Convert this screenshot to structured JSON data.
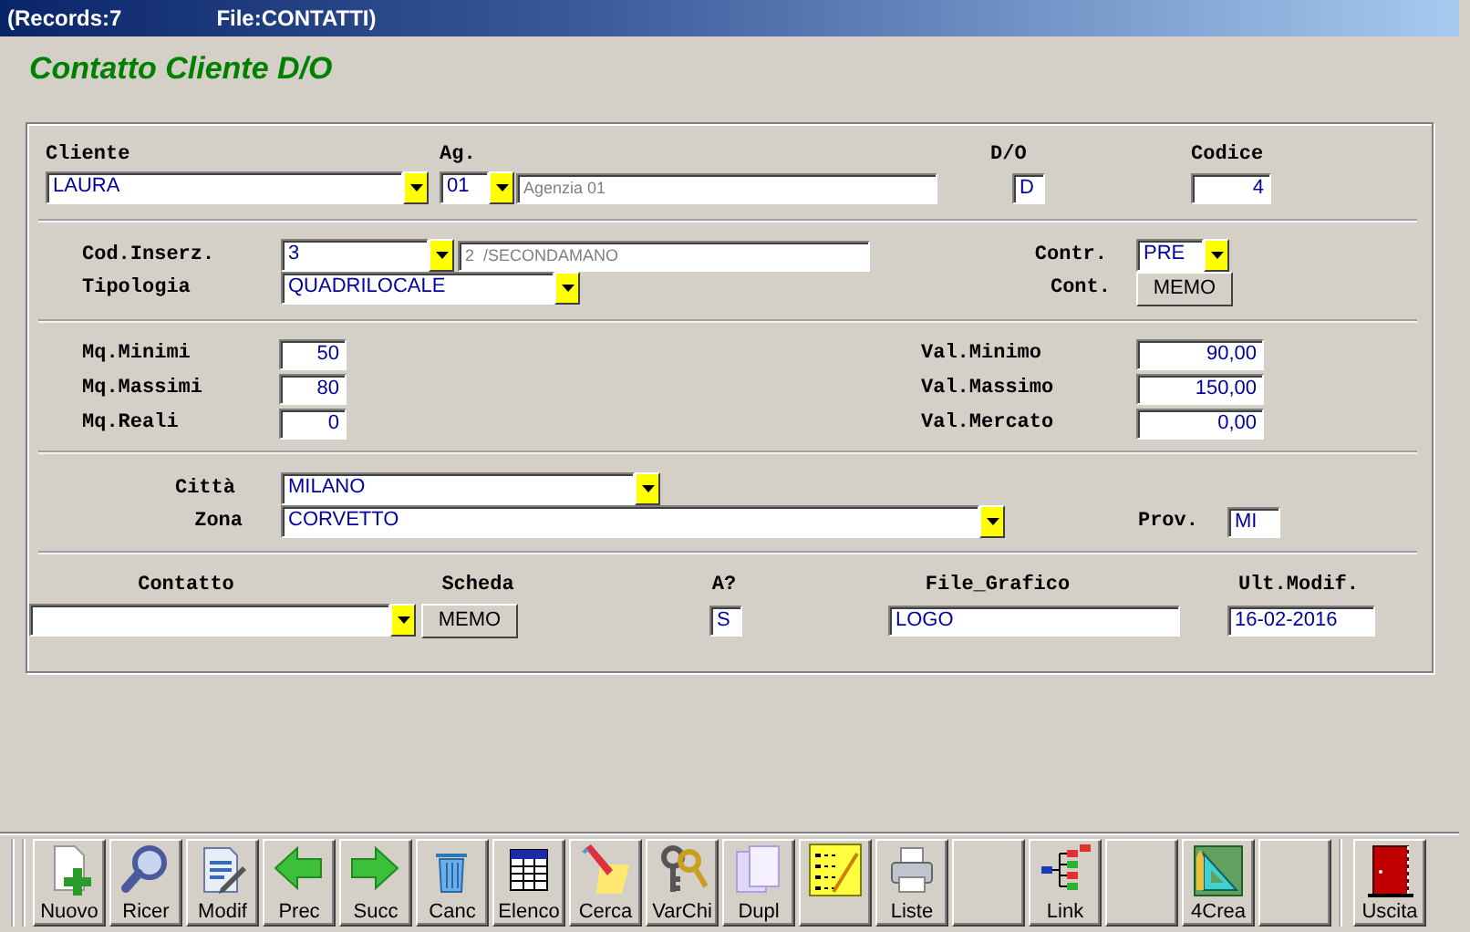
{
  "window": {
    "records": "(Records:7",
    "file": "File:CONTATTI)"
  },
  "heading": "Contatto Cliente D/O",
  "sections": [
    {
      "rows": [
        {
          "items": [
            {
              "kind": "label",
              "text": "Cliente"
            },
            {
              "kind": "label",
              "text": "Ag."
            },
            {
              "kind": "label",
              "text": "D/O"
            },
            {
              "kind": "label",
              "text": "Codice"
            }
          ]
        },
        {
          "items": [
            {
              "kind": "combo",
              "value": "LAURA"
            },
            {
              "kind": "combo",
              "value": "01"
            },
            {
              "kind": "description",
              "value": "Agenzia 01"
            },
            {
              "kind": "field",
              "value": "D"
            },
            {
              "kind": "number",
              "value": "4"
            }
          ]
        }
      ]
    },
    {
      "rows": [
        {
          "items": [
            {
              "kind": "label",
              "text": "Cod.Inserz."
            },
            {
              "kind": "combo",
              "value": "3"
            },
            {
              "kind": "description",
              "value": "2  /SECONDAMANO"
            },
            {
              "kind": "label",
              "text": "Contr."
            },
            {
              "kind": "combo",
              "value": "PRE"
            }
          ]
        },
        {
          "items": [
            {
              "kind": "label",
              "text": "Tipologia"
            },
            {
              "kind": "combo",
              "value": "QUADRILOCALE"
            },
            {
              "kind": "label",
              "text": "Cont."
            },
            {
              "kind": "memo",
              "label": "MEMO"
            }
          ]
        }
      ]
    },
    {
      "rows": [
        {
          "items": [
            {
              "kind": "label",
              "text": "Mq.Minimi"
            },
            {
              "kind": "number",
              "value": "50"
            },
            {
              "kind": "label",
              "text": "Val.Minimo"
            },
            {
              "kind": "number",
              "value": "90,00"
            }
          ]
        },
        {
          "items": [
            {
              "kind": "label",
              "text": "Mq.Massimi"
            },
            {
              "kind": "number",
              "value": "80"
            },
            {
              "kind": "label",
              "text": "Val.Massimo"
            },
            {
              "kind": "number",
              "value": "150,00"
            }
          ]
        },
        {
          "items": [
            {
              "kind": "label",
              "text": "Mq.Reali"
            },
            {
              "kind": "number",
              "value": "0"
            },
            {
              "kind": "label",
              "text": "Val.Mercato"
            },
            {
              "kind": "number",
              "value": "0,00"
            }
          ]
        }
      ]
    },
    {
      "rows": [
        {
          "items": [
            {
              "kind": "label",
              "text": "Città"
            },
            {
              "kind": "combo",
              "value": "MILANO"
            }
          ]
        },
        {
          "items": [
            {
              "kind": "label",
              "text": "Zona"
            },
            {
              "kind": "combo",
              "value": "CORVETTO"
            },
            {
              "kind": "label",
              "text": "Prov."
            },
            {
              "kind": "field",
              "value": "MI"
            }
          ]
        }
      ]
    },
    {
      "rows": [
        {
          "items": [
            {
              "kind": "label",
              "text": "Contatto"
            },
            {
              "kind": "label",
              "text": "Scheda"
            },
            {
              "kind": "label",
              "text": "A?"
            },
            {
              "kind": "label",
              "text": "File_Grafico"
            },
            {
              "kind": "label",
              "text": "Ult.Modif."
            }
          ]
        },
        {
          "items": [
            {
              "kind": "combo"
            },
            {
              "kind": "memo",
              "label": "MEMO"
            },
            {
              "kind": "field",
              "value": "S"
            },
            {
              "kind": "field",
              "value": "LOGO"
            },
            {
              "kind": "field",
              "value": "16-02-2016"
            }
          ]
        }
      ]
    }
  ],
  "toolbar": [
    {
      "kind": "button",
      "label": "Nuovo"
    },
    {
      "kind": "button",
      "label": "Ricer"
    },
    {
      "kind": "button",
      "label": "Modif"
    },
    {
      "kind": "button",
      "label": "Prec"
    },
    {
      "kind": "button",
      "label": "Succ"
    },
    {
      "kind": "button",
      "label": "Canc"
    },
    {
      "kind": "button",
      "label": "Elenco"
    },
    {
      "kind": "button",
      "label": "Cerca"
    },
    {
      "kind": "button",
      "label": "VarChi"
    },
    {
      "kind": "button",
      "label": "Dupl"
    },
    {
      "kind": "button"
    },
    {
      "kind": "button",
      "label": "Liste"
    },
    {
      "kind": "blank"
    },
    {
      "kind": "button",
      "label": "Link"
    },
    {
      "kind": "blank"
    },
    {
      "kind": "button",
      "label": "4Crea"
    },
    {
      "kind": "blank"
    },
    {
      "kind": "separator"
    },
    {
      "kind": "button",
      "label": "Uscita"
    }
  ]
}
